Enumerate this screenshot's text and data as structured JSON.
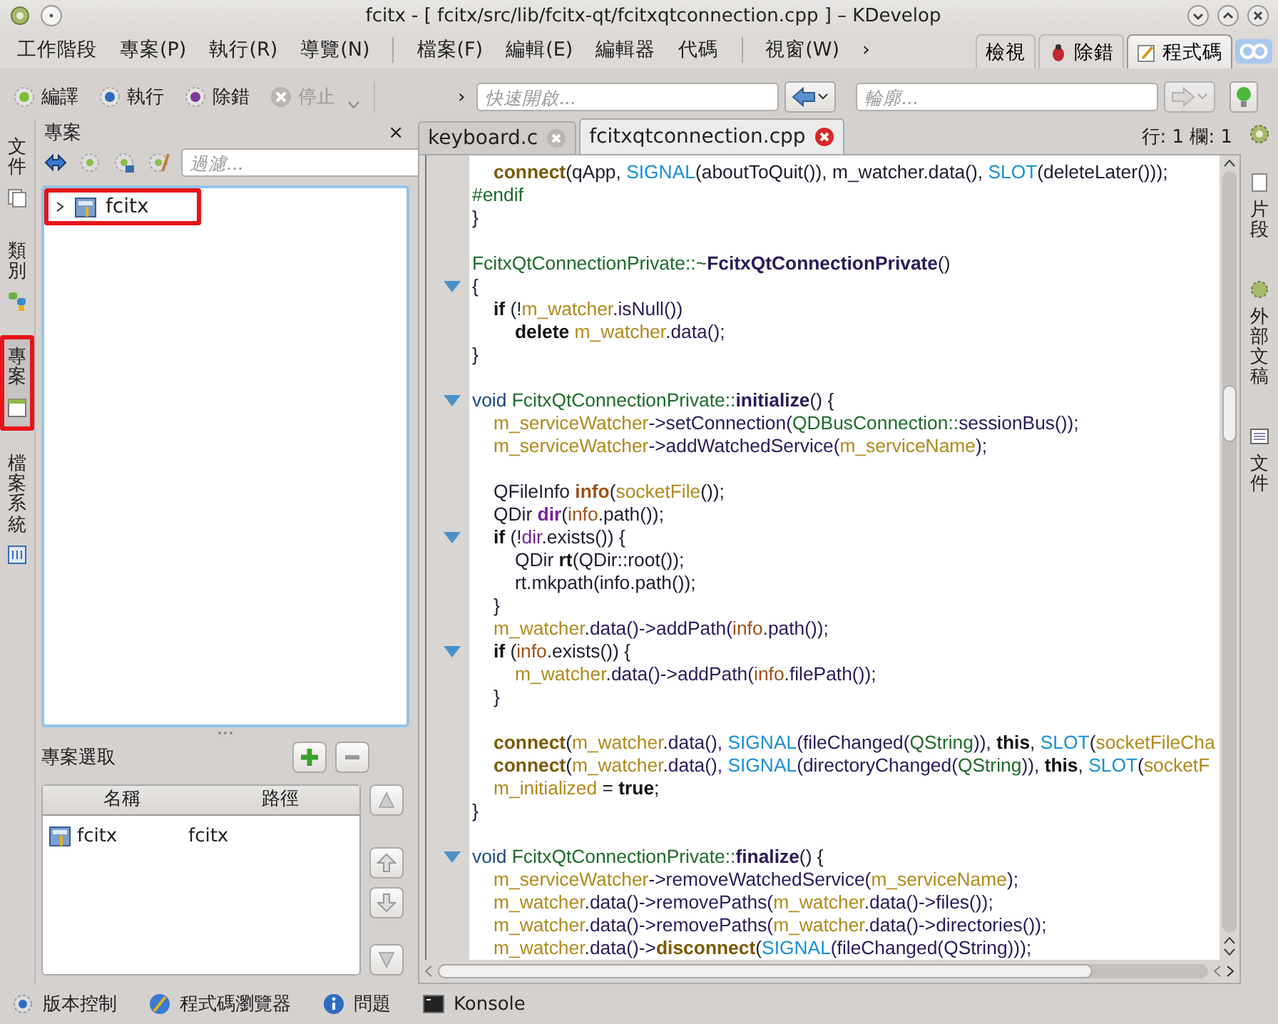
{
  "window": {
    "title": "fcitx - [ fcitx/src/lib/fcitx-qt/fcitxqtconnection.cpp ] – KDevelop"
  },
  "menu_bar": [
    {
      "kind": "item",
      "label": "工作階段"
    },
    {
      "kind": "item",
      "label": "專案(P)"
    },
    {
      "kind": "item",
      "label": "執行(R)"
    },
    {
      "kind": "item",
      "label": "導覽(N)"
    },
    {
      "kind": "separator"
    },
    {
      "kind": "item",
      "label": "檔案(F)"
    },
    {
      "kind": "item",
      "label": "編輯(E)"
    },
    {
      "kind": "item",
      "label": "編輯器"
    },
    {
      "kind": "item",
      "label": "代碼"
    },
    {
      "kind": "separator"
    },
    {
      "kind": "item",
      "label": "視窗(W)"
    },
    {
      "kind": "item",
      "label": "›"
    }
  ],
  "area_tabs": [
    {
      "label": "檢視",
      "kind": "view",
      "selected": false
    },
    {
      "label": "除錯",
      "kind": "debug",
      "selected": false
    },
    {
      "label": "程式碼",
      "kind": "code",
      "selected": true
    }
  ],
  "toolbar": {
    "buttons": [
      {
        "label": "編譯",
        "kind": "build",
        "disabled": false
      },
      {
        "label": "執行",
        "kind": "run",
        "disabled": false
      },
      {
        "label": "除錯",
        "kind": "debug",
        "disabled": false
      },
      {
        "label": "停止",
        "kind": "stop",
        "disabled": true
      }
    ],
    "overflow": "›",
    "quick_open": {
      "placeholder": "快速開啟..."
    },
    "outline": {
      "placeholder": "輪廓..."
    },
    "nav_buttons": [
      {
        "kind": "back",
        "disabled": false
      },
      {
        "kind": "forward",
        "disabled": true
      }
    ]
  },
  "left_dock_tabs": [
    {
      "label": "文件",
      "kind": "documents",
      "selected": false,
      "highlighted": false
    },
    {
      "label": "類別",
      "kind": "classes",
      "selected": false,
      "highlighted": false
    },
    {
      "label": "專案",
      "kind": "projects",
      "selected": true,
      "highlighted": true
    },
    {
      "label": "檔案系統",
      "kind": "filesystem",
      "selected": false,
      "highlighted": false
    }
  ],
  "project_panel": {
    "title": "專案",
    "close": "×",
    "filter": {
      "placeholder": "過濾..."
    },
    "tree": [
      {
        "label": "fcitx",
        "expanded": false,
        "highlighted": true
      }
    ]
  },
  "project_selection": {
    "title": "專案選取",
    "columns": [
      "名稱",
      "路徑"
    ],
    "rows": [
      [
        "fcitx",
        "fcitx"
      ]
    ]
  },
  "editor": {
    "tabs": [
      {
        "label": "keyboard.c",
        "selected": false
      },
      {
        "label": "fcitxqtconnection.cpp",
        "selected": true
      }
    ],
    "cursor": "行: 1 欄: 1",
    "lines": [
      {
        "fold": false,
        "kind": "inner",
        "tokens": [
          {
            "kind": "call",
            "text": "connect"
          },
          {
            "kind": "p",
            "text": "(qApp, "
          },
          {
            "kind": "mac",
            "text": "SIGNAL"
          },
          {
            "kind": "p",
            "text": "(aboutToQuit()), m_watcher.data(), "
          },
          {
            "kind": "mac",
            "text": "SLOT"
          },
          {
            "kind": "p",
            "text": "(deleteLater()));"
          }
        ]
      },
      {
        "fold": false,
        "kind": "top",
        "tokens": [
          {
            "kind": "type",
            "text": "#endif"
          }
        ]
      },
      {
        "fold": false,
        "kind": "top",
        "tokens": [
          {
            "kind": "p",
            "text": "}"
          }
        ]
      },
      {
        "kind": "blank"
      },
      {
        "fold": false,
        "kind": "top",
        "tokens": [
          {
            "kind": "type",
            "text": "FcitxQtConnectionPrivate::~"
          },
          {
            "kind": "decl",
            "text": "FcitxQtConnectionPrivate"
          },
          {
            "kind": "p",
            "text": "()"
          }
        ]
      },
      {
        "fold": true,
        "kind": "top",
        "tokens": [
          {
            "kind": "p",
            "text": "{"
          }
        ]
      },
      {
        "fold": false,
        "kind": "inner",
        "tokens": [
          {
            "kind": "kw",
            "text": "if"
          },
          {
            "kind": "p",
            "text": " (!"
          },
          {
            "kind": "mem",
            "text": "m_watcher"
          },
          {
            "kind": "fn",
            "text": ".isNull())"
          }
        ]
      },
      {
        "fold": false,
        "kind": "deep",
        "tokens": [
          {
            "kind": "kw",
            "text": "delete "
          },
          {
            "kind": "mem",
            "text": "m_watcher"
          },
          {
            "kind": "fn",
            "text": ".data();"
          }
        ]
      },
      {
        "fold": false,
        "kind": "top",
        "tokens": [
          {
            "kind": "p",
            "text": "}"
          }
        ]
      },
      {
        "kind": "blank"
      },
      {
        "fold": true,
        "kind": "top",
        "tokens": [
          {
            "kind": "void",
            "text": "void "
          },
          {
            "kind": "type",
            "text": "FcitxQtConnectionPrivate::"
          },
          {
            "kind": "decl",
            "text": "initialize"
          },
          {
            "kind": "p",
            "text": "() {"
          }
        ]
      },
      {
        "fold": false,
        "kind": "inner",
        "tokens": [
          {
            "kind": "mem",
            "text": "m_serviceWatcher"
          },
          {
            "kind": "fn",
            "text": "->setConnection("
          },
          {
            "kind": "type",
            "text": "QDBusConnection::"
          },
          {
            "kind": "fn",
            "text": "sessionBus());"
          }
        ]
      },
      {
        "fold": false,
        "kind": "inner",
        "tokens": [
          {
            "kind": "mem",
            "text": "m_serviceWatcher"
          },
          {
            "kind": "fn",
            "text": "->addWatchedService("
          },
          {
            "kind": "mem",
            "text": "m_serviceName"
          },
          {
            "kind": "fn",
            "text": ");"
          }
        ]
      },
      {
        "kind": "blank"
      },
      {
        "fold": false,
        "kind": "inner",
        "tokens": [
          {
            "kind": "p",
            "text": "QFileInfo "
          },
          {
            "kind": "ldecl",
            "text": "info"
          },
          {
            "kind": "p",
            "text": "("
          },
          {
            "kind": "mem",
            "text": "socketFile"
          },
          {
            "kind": "p",
            "text": "());"
          }
        ]
      },
      {
        "fold": false,
        "kind": "inner",
        "tokens": [
          {
            "kind": "p",
            "text": "QDir "
          },
          {
            "kind": "pdecl",
            "text": "dir"
          },
          {
            "kind": "p",
            "text": "("
          },
          {
            "kind": "loc",
            "text": "info"
          },
          {
            "kind": "p",
            "text": ".path());"
          }
        ]
      },
      {
        "fold": true,
        "kind": "inner",
        "tokens": [
          {
            "kind": "kw",
            "text": "if"
          },
          {
            "kind": "p",
            "text": " (!"
          },
          {
            "kind": "pur",
            "text": "dir"
          },
          {
            "kind": "p",
            "text": ".exists()) {"
          }
        ]
      },
      {
        "fold": false,
        "kind": "deep",
        "tokens": [
          {
            "kind": "p",
            "text": "QDir "
          },
          {
            "kind": "kw",
            "text": "rt"
          },
          {
            "kind": "p",
            "text": "(QDir::root());"
          }
        ]
      },
      {
        "fold": false,
        "kind": "deep",
        "tokens": [
          {
            "kind": "p",
            "text": "rt.mkpath(info.path());"
          }
        ]
      },
      {
        "fold": false,
        "kind": "inner",
        "tokens": [
          {
            "kind": "p",
            "text": "}"
          }
        ]
      },
      {
        "fold": false,
        "kind": "inner",
        "tokens": [
          {
            "kind": "mem",
            "text": "m_watcher"
          },
          {
            "kind": "fn",
            "text": ".data()->addPath("
          },
          {
            "kind": "loc",
            "text": "info"
          },
          {
            "kind": "fn",
            "text": ".path());"
          }
        ]
      },
      {
        "fold": true,
        "kind": "inner",
        "tokens": [
          {
            "kind": "kw",
            "text": "if"
          },
          {
            "kind": "p",
            "text": " ("
          },
          {
            "kind": "loc",
            "text": "info"
          },
          {
            "kind": "p",
            "text": ".exists()) {"
          }
        ]
      },
      {
        "fold": false,
        "kind": "deep",
        "tokens": [
          {
            "kind": "mem",
            "text": "m_watcher"
          },
          {
            "kind": "fn",
            "text": ".data()->addPath("
          },
          {
            "kind": "loc",
            "text": "info"
          },
          {
            "kind": "fn",
            "text": ".filePath());"
          }
        ]
      },
      {
        "fold": false,
        "kind": "inner",
        "tokens": [
          {
            "kind": "p",
            "text": "}"
          }
        ]
      },
      {
        "kind": "blank"
      },
      {
        "fold": false,
        "kind": "inner",
        "tokens": [
          {
            "kind": "call",
            "text": "connect"
          },
          {
            "kind": "p",
            "text": "("
          },
          {
            "kind": "mem",
            "text": "m_watcher"
          },
          {
            "kind": "fn",
            "text": ".data(), "
          },
          {
            "kind": "mac",
            "text": "SIGNAL"
          },
          {
            "kind": "fn",
            "text": "(fileChanged("
          },
          {
            "kind": "type",
            "text": "QString"
          },
          {
            "kind": "fn",
            "text": ")), "
          },
          {
            "kind": "kw",
            "text": "this"
          },
          {
            "kind": "p",
            "text": ", "
          },
          {
            "kind": "mac",
            "text": "SLOT"
          },
          {
            "kind": "p",
            "text": "("
          },
          {
            "kind": "mem",
            "text": "socketFileCha"
          }
        ]
      },
      {
        "fold": false,
        "kind": "inner",
        "tokens": [
          {
            "kind": "call",
            "text": "connect"
          },
          {
            "kind": "p",
            "text": "("
          },
          {
            "kind": "mem",
            "text": "m_watcher"
          },
          {
            "kind": "fn",
            "text": ".data(), "
          },
          {
            "kind": "mac",
            "text": "SIGNAL"
          },
          {
            "kind": "fn",
            "text": "(directoryChanged("
          },
          {
            "kind": "type",
            "text": "QString"
          },
          {
            "kind": "fn",
            "text": ")), "
          },
          {
            "kind": "kw",
            "text": "this"
          },
          {
            "kind": "p",
            "text": ", "
          },
          {
            "kind": "mac",
            "text": "SLOT"
          },
          {
            "kind": "p",
            "text": "("
          },
          {
            "kind": "mem",
            "text": "socketF"
          }
        ]
      },
      {
        "fold": false,
        "kind": "inner",
        "tokens": [
          {
            "kind": "mem",
            "text": "m_initialized"
          },
          {
            "kind": "p",
            "text": " = "
          },
          {
            "kind": "kw",
            "text": "true"
          },
          {
            "kind": "p",
            "text": ";"
          }
        ]
      },
      {
        "fold": false,
        "kind": "top",
        "tokens": [
          {
            "kind": "p",
            "text": "}"
          }
        ]
      },
      {
        "kind": "blank"
      },
      {
        "fold": true,
        "kind": "top",
        "tokens": [
          {
            "kind": "void",
            "text": "void "
          },
          {
            "kind": "type",
            "text": "FcitxQtConnectionPrivate::"
          },
          {
            "kind": "decl",
            "text": "finalize"
          },
          {
            "kind": "p",
            "text": "() {"
          }
        ]
      },
      {
        "fold": false,
        "kind": "inner",
        "tokens": [
          {
            "kind": "mem",
            "text": "m_serviceWatcher"
          },
          {
            "kind": "fn",
            "text": "->removeWatchedService("
          },
          {
            "kind": "mem",
            "text": "m_serviceName"
          },
          {
            "kind": "fn",
            "text": ");"
          }
        ]
      },
      {
        "fold": false,
        "kind": "inner",
        "tokens": [
          {
            "kind": "mem",
            "text": "m_watcher"
          },
          {
            "kind": "fn",
            "text": ".data()->removePaths("
          },
          {
            "kind": "mem",
            "text": "m_watcher"
          },
          {
            "kind": "fn",
            "text": ".data()->files());"
          }
        ]
      },
      {
        "fold": false,
        "kind": "inner",
        "tokens": [
          {
            "kind": "mem",
            "text": "m_watcher"
          },
          {
            "kind": "fn",
            "text": ".data()->removePaths("
          },
          {
            "kind": "mem",
            "text": "m_watcher"
          },
          {
            "kind": "fn",
            "text": ".data()->directories());"
          }
        ]
      },
      {
        "fold": false,
        "kind": "inner",
        "tokens": [
          {
            "kind": "mem",
            "text": "m_watcher"
          },
          {
            "kind": "fn",
            "text": ".data()->"
          },
          {
            "kind": "call",
            "text": "disconnect"
          },
          {
            "kind": "p",
            "text": "("
          },
          {
            "kind": "mac",
            "text": "SIGNAL"
          },
          {
            "kind": "fn",
            "text": "(fileChanged(QString)));"
          }
        ]
      }
    ]
  },
  "right_dock_tabs": [
    {
      "label": "片段",
      "kind": "snippets",
      "selected": false
    },
    {
      "label": "外部文稿",
      "kind": "scripts",
      "selected": false
    },
    {
      "label": "文件",
      "kind": "documentation",
      "selected": false
    }
  ],
  "status_bar": [
    {
      "label": "版本控制",
      "kind": "vcs"
    },
    {
      "label": "程式碼瀏覽器",
      "kind": "browser"
    },
    {
      "label": "問題",
      "kind": "problems"
    },
    {
      "label": "Konsole",
      "kind": "terminal"
    }
  ]
}
